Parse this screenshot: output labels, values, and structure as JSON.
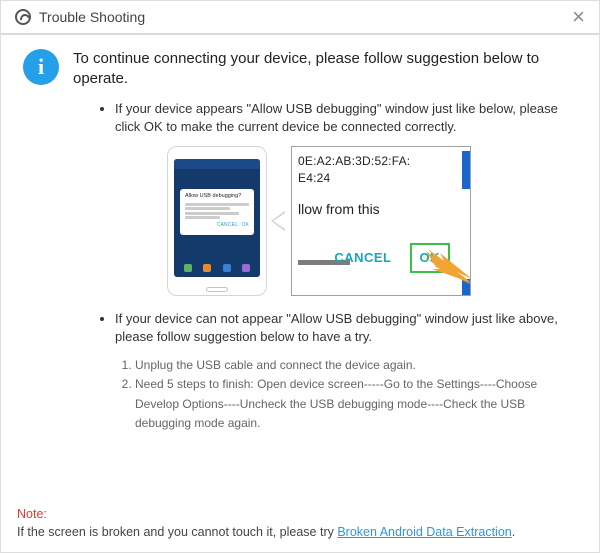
{
  "window": {
    "title": "Trouble Shooting"
  },
  "intro": "To continue connecting your device, please follow suggestion below to operate.",
  "suggestions": [
    {
      "text": "If your device appears \"Allow USB debugging\" window just like below, please click OK to make the current device  be connected correctly."
    },
    {
      "text": "If your device can not appear \"Allow USB debugging\" window just like above, please follow suggestion below to have a try.",
      "steps": [
        "Unplug the USB cable and connect the device again.",
        "Need 5 steps to finish: Open device screen-----Go to the Settings----Choose Develop Options----Uncheck the USB debugging mode----Check the USB debugging mode again."
      ]
    }
  ],
  "phone_dialog": {
    "title": "Allow USB debugging?",
    "sub1": "The computer's RSA key fingerprint is:",
    "sub2": "Always allow from this computer"
  },
  "crop_dialog": {
    "mac_line1": "0E:A2:AB:3D:52:FA:",
    "mac_line2": "E4:24",
    "from_text": "llow from this",
    "cancel": "CANCEL",
    "ok": "OK"
  },
  "note": {
    "label": "Note:",
    "text": "If the screen is broken and you cannot touch it, please try ",
    "link": "Broken Android Data Extraction",
    "tail": "."
  }
}
